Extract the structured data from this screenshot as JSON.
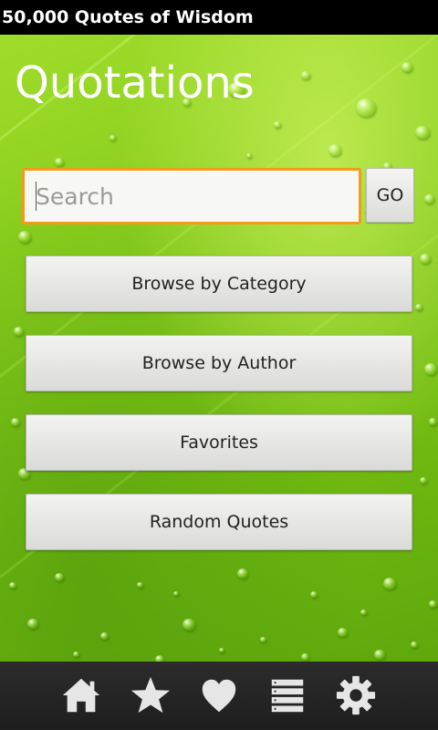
{
  "app": {
    "window_title": "50,000 Quotes of Wisdom"
  },
  "main": {
    "heading": "Quotations",
    "search": {
      "placeholder": "Search",
      "value": ""
    },
    "go_label": "GO",
    "menu": [
      {
        "label": "Browse by Category"
      },
      {
        "label": "Browse by Author"
      },
      {
        "label": "Favorites"
      },
      {
        "label": "Random Quotes"
      }
    ]
  },
  "bottom_nav": {
    "icons": [
      "home-icon",
      "star-icon",
      "heart-icon",
      "list-icon",
      "gear-icon"
    ]
  },
  "colors": {
    "accent_focus": "#f59a18",
    "leaf_green": "#86cc1c",
    "bar_dark": "#1e1e1e",
    "icon_light": "#e6e6e6"
  }
}
